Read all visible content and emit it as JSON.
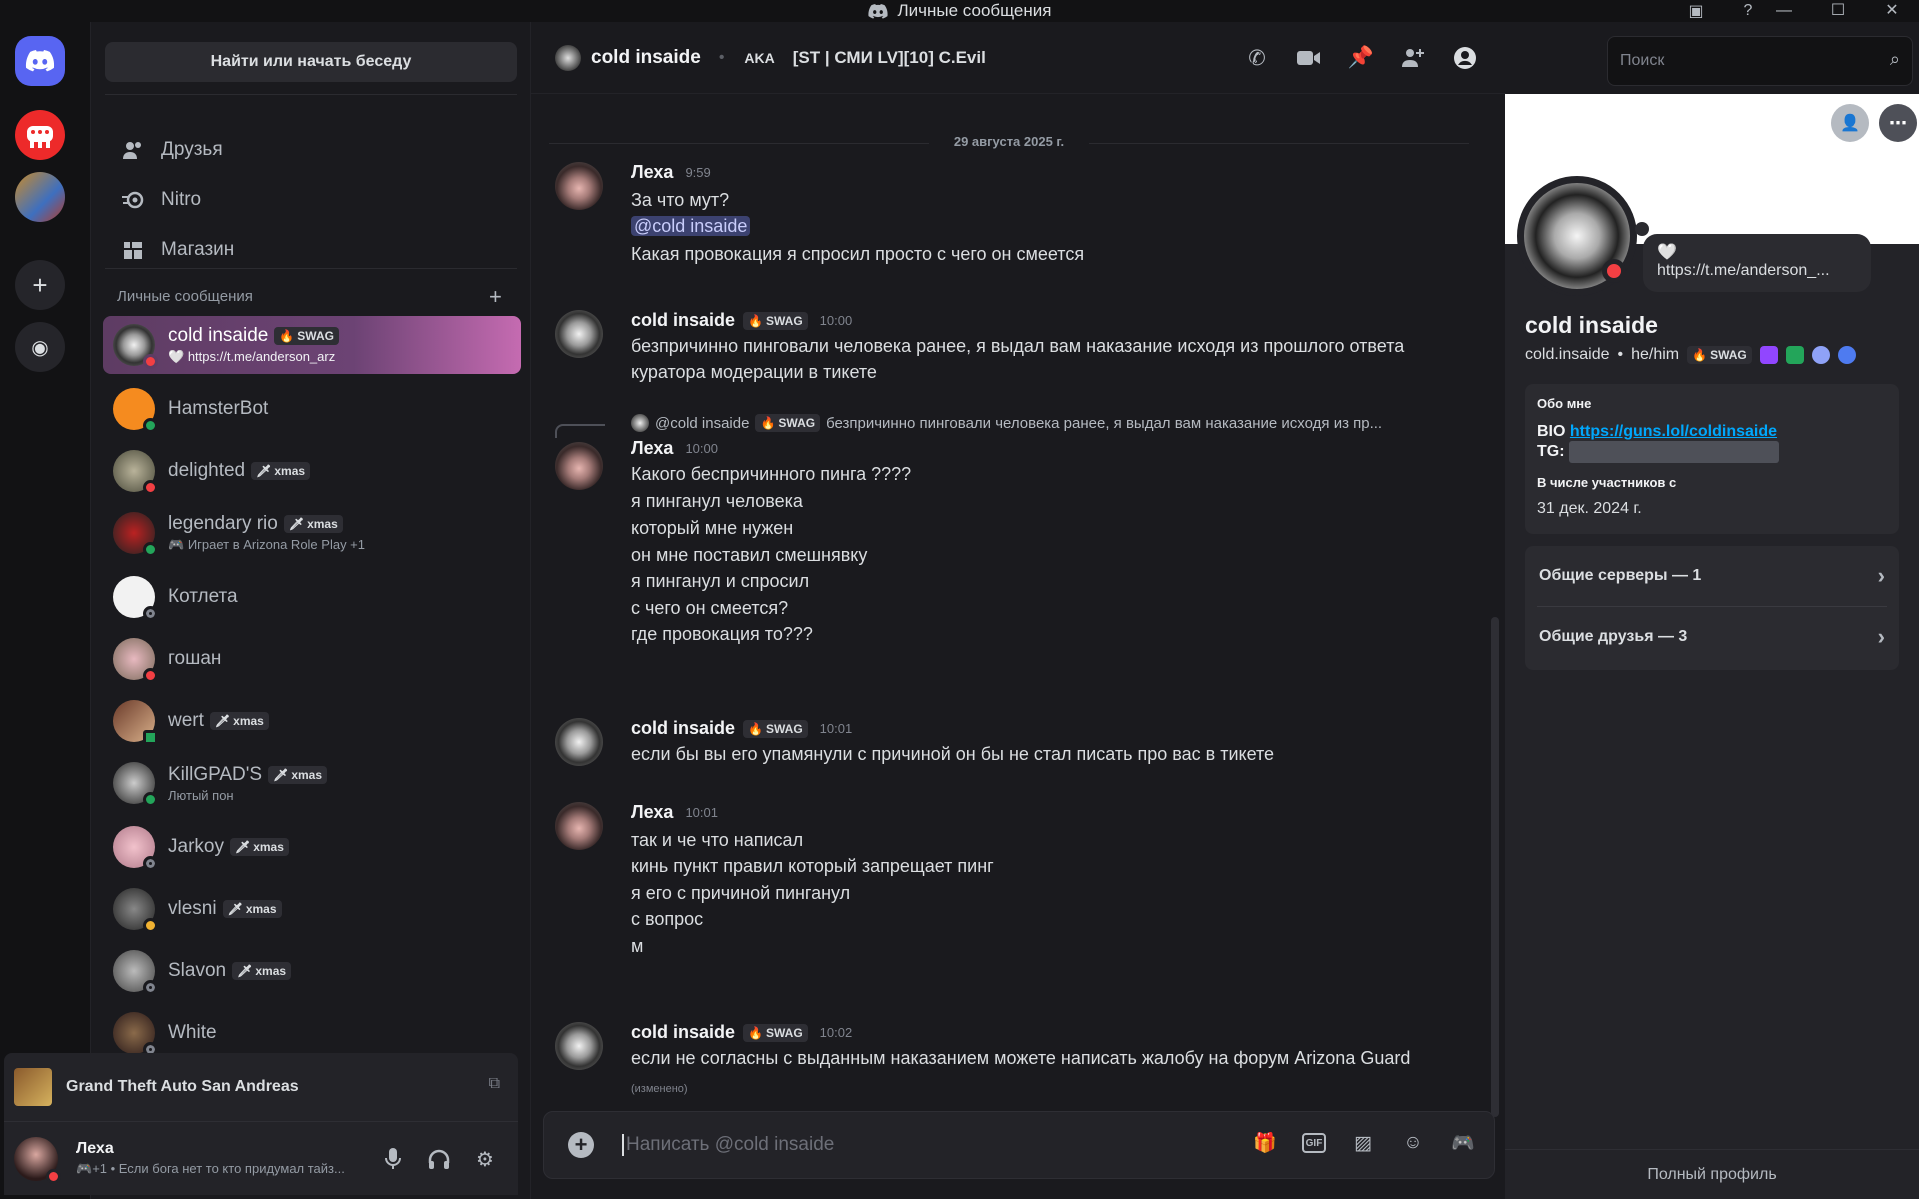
{
  "window": {
    "title": "Личные сообщения",
    "minimize": "—",
    "maximize": "☐",
    "close": "✕"
  },
  "sidebar": {
    "find_label": "Найти или начать беседу",
    "nav": [
      {
        "label": "Друзья",
        "icon": "friends-icon"
      },
      {
        "label": "Nitro",
        "icon": "nitro-icon"
      },
      {
        "label": "Магазин",
        "icon": "shop-icon"
      }
    ],
    "dm_header": "Личные сообщения",
    "dms": [
      {
        "name": "cold insaide",
        "tag": "SWAG",
        "sub": "https://t.me/anderson_arz",
        "status": "dnd",
        "active": true
      },
      {
        "name": "HamsterBot",
        "tag": "",
        "sub": "",
        "status": "online"
      },
      {
        "name": "delighted",
        "tag": "xmas",
        "sub": "",
        "status": "dnd"
      },
      {
        "name": "legendary rio",
        "tag": "xmas",
        "sub": "Играет в Arizona Role Play +1",
        "status": "online"
      },
      {
        "name": "Котлета",
        "tag": "",
        "sub": "",
        "status": "offline"
      },
      {
        "name": "гошан",
        "tag": "",
        "sub": "",
        "status": "dnd"
      },
      {
        "name": "wert",
        "tag": "xmas",
        "sub": "",
        "status": "online"
      },
      {
        "name": "KillGPAD'S",
        "tag": "xmas",
        "sub": "Лютый пон",
        "status": "online"
      },
      {
        "name": "Jarkoy",
        "tag": "xmas",
        "sub": "",
        "status": "offline"
      },
      {
        "name": "vlesni",
        "tag": "xmas",
        "sub": "",
        "status": "idle"
      },
      {
        "name": "Slavon",
        "tag": "xmas",
        "sub": "",
        "status": "offline"
      },
      {
        "name": "White",
        "tag": "",
        "sub": "",
        "status": "offline"
      }
    ],
    "game": "Grand Theft Auto San Andreas",
    "user": {
      "name": "Леха",
      "status_text": "+1 • Если бога нет то кто придумал тайз..."
    }
  },
  "chat": {
    "recipient": "cold insaide",
    "aka_label": "AKA",
    "aka_name": "[ST | СМИ LV][10] C.Evil",
    "search_placeholder": "Поиск",
    "date": "29 августа 2025 г.",
    "messages": [
      {
        "author": "Леха",
        "time": "9:59",
        "lines": [
          "За что мут?",
          "@cold insaide",
          "Какая провокация я спросил просто с чего он смеется"
        ]
      },
      {
        "author": "cold insaide",
        "tag": "SWAG",
        "time": "10:00",
        "lines": [
          "безпричинно пинговали человека ранее, я выдал вам наказание исходя из прошлого ответа",
          "куратора модерации в тикете"
        ]
      },
      {
        "author": "Леха",
        "time": "10:00",
        "reply": {
          "author": "@cold insaide",
          "tag": "SWAG",
          "text": "безпричинно пинговали человека ранее, я выдал вам наказание исходя из пр..."
        },
        "lines": [
          "Какого беспричинного пинга ????",
          "я пинганул человека",
          "который мне нужен",
          "он мне поставил смешнявку",
          "я пинганул и спросил",
          "с чего он смеется?",
          "где провокация то???"
        ]
      },
      {
        "author": "cold insaide",
        "tag": "SWAG",
        "time": "10:01",
        "lines": [
          "если бы вы его упамянули с причиной он бы не стал писать про вас в тикете"
        ]
      },
      {
        "author": "Леха",
        "time": "10:01",
        "lines": [
          "так и че что написал",
          "кинь пункт правил который запрещает пинг",
          "я его с причиной пинганул",
          "с вопрос",
          "м"
        ]
      },
      {
        "author": "cold insaide",
        "tag": "SWAG",
        "time": "10:02",
        "lines": [
          "если не согласны с выданным наказанием можете написать жалобу на форум Arizona Guard"
        ],
        "edited": "(изменено)"
      }
    ],
    "composer_placeholder": "Написать @cold insaide"
  },
  "profile": {
    "name": "cold insaide",
    "username": "cold.insaide",
    "pronouns": "he/him",
    "tag": "SWAG",
    "custom_status": "https://t.me/anderson_...",
    "about_header": "Обо мне",
    "bio_label": "BIO",
    "bio_link": "https://guns.lol/coldinsaide",
    "tg_label": "TG:",
    "member_since_header": "В числе участников с",
    "member_since": "31 дек. 2024 г.",
    "mutual_servers": "Общие серверы — 1",
    "mutual_friends": "Общие друзья — 3",
    "full_profile": "Полный профиль"
  },
  "colors": {
    "accent": "#5865f2",
    "online": "#23a55a",
    "dnd": "#f23f43",
    "idle": "#f0b232",
    "link": "#00a8fc"
  }
}
